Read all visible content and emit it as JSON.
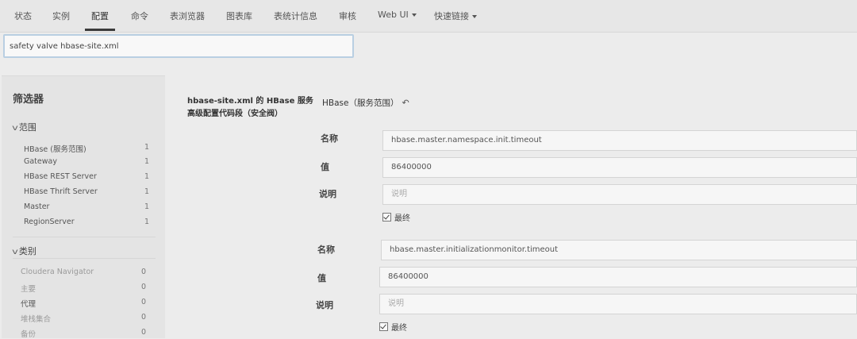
{
  "nav": {
    "items": [
      {
        "label": "状态"
      },
      {
        "label": "实例"
      },
      {
        "label": "配置",
        "active": true
      },
      {
        "label": "命令"
      },
      {
        "label": "表浏览器"
      },
      {
        "label": "图表库"
      },
      {
        "label": "表统计信息"
      },
      {
        "label": "审核"
      },
      {
        "label": "Web UI",
        "dropdown": true
      },
      {
        "label": "快速链接",
        "dropdown": true
      }
    ]
  },
  "search": {
    "value": "safety valve hbase-site.xml"
  },
  "sidebar": {
    "title": "筛选器",
    "groups": [
      {
        "label": "范围",
        "items": [
          {
            "label": "HBase (服务范围)",
            "count": "1"
          },
          {
            "label": "Gateway",
            "count": "1"
          },
          {
            "label": "HBase REST Server",
            "count": "1"
          },
          {
            "label": "HBase Thrift Server",
            "count": "1"
          },
          {
            "label": "Master",
            "count": "1"
          },
          {
            "label": "RegionServer",
            "count": "1"
          }
        ]
      },
      {
        "label": "类别",
        "items": [
          {
            "label": "Cloudera Navigator",
            "count": "0"
          },
          {
            "label": "主要",
            "count": "0"
          },
          {
            "label": "代理",
            "count": "0"
          },
          {
            "label": "堆栈集合",
            "count": "0"
          },
          {
            "label": "备份",
            "count": "0"
          }
        ]
      }
    ]
  },
  "config": {
    "title": "hbase-site.xml 的 HBase 服务高级配置代码段（安全阀）",
    "scope": "HBase（服务范围）",
    "entries": [
      {
        "name_label": "名称",
        "name_value": "hbase.master.namespace.init.timeout",
        "value_label": "值",
        "value_value": "86400000",
        "desc_label": "说明",
        "desc_placeholder": "说明",
        "final_label": "最终"
      },
      {
        "name_label": "名称",
        "name_value": "hbase.master.initializationmonitor.timeout",
        "value_label": "值",
        "value_value": "86400000",
        "desc_label": "说明",
        "desc_placeholder": "说明",
        "final_label": "最终"
      }
    ]
  }
}
